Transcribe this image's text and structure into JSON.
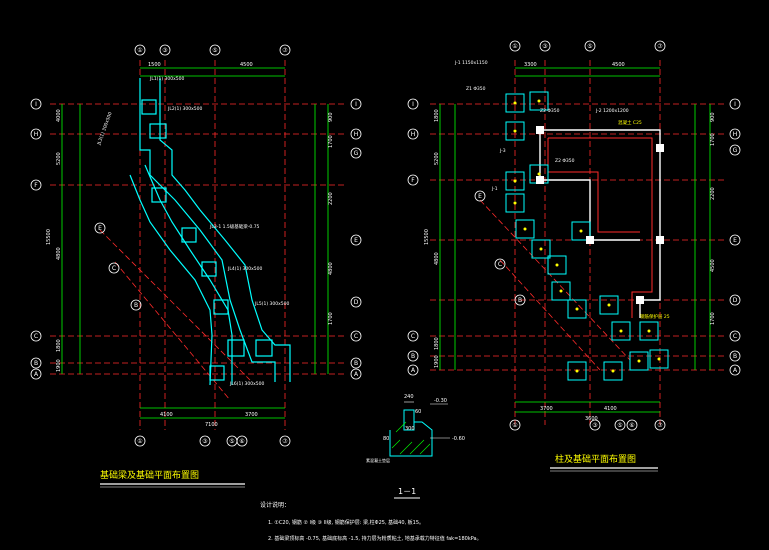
{
  "left_plan": {
    "title": "基础梁及基础平面布置图",
    "top_axes": [
      "①",
      "③",
      "⑤",
      "⑦"
    ],
    "bottom_axes": [
      "①",
      "③",
      "⑤",
      "⑥",
      "⑦"
    ],
    "left_axes": [
      "I",
      "H",
      "F",
      "C",
      "B",
      "A"
    ],
    "right_axes": [
      "I",
      "H",
      "G",
      "E",
      "D",
      "C",
      "B",
      "A"
    ],
    "diag_axes": [
      "E",
      "C",
      "B"
    ],
    "dims_top": [
      "1500",
      "4500"
    ],
    "dims_left": [
      "4000",
      "5200",
      "4800",
      "1800",
      "1900",
      "15500"
    ],
    "dims_right": [
      "900",
      "1700",
      "2200",
      "4800",
      "1700"
    ],
    "dims_bottom": [
      "4100",
      "3700",
      "7100"
    ],
    "beam_tags": [
      "JL1(1)  300x500",
      "JL2(1)  300x500",
      "JL3(1)  300x500",
      "JL4(1)  300x500",
      "JL5(1)  300x500",
      "JL6(1)  300x500"
    ],
    "note_center": "JL3-1  1.5级基础梁-0.75"
  },
  "right_plan": {
    "title": "柱及基础平面布置图",
    "top_axes": [
      "①",
      "③",
      "⑤",
      "⑦"
    ],
    "bottom_axes": [
      "①",
      "③",
      "⑤",
      "⑥",
      "⑦"
    ],
    "left_axes": [
      "I",
      "H",
      "F",
      "C",
      "B",
      "A"
    ],
    "right_axes": [
      "I",
      "H",
      "G",
      "E",
      "D",
      "C",
      "B",
      "A"
    ],
    "diag_axes": [
      "E",
      "C",
      "B"
    ],
    "dims_top": [
      "3300",
      "4500"
    ],
    "dims_left": [
      "1800",
      "5200",
      "4800",
      "1800",
      "1900",
      "15500"
    ],
    "dims_right": [
      "900",
      "1700",
      "2200",
      "4500",
      "1700"
    ],
    "dims_bottom": [
      "3700",
      "4100",
      "3600"
    ],
    "tags": {
      "z_top": "J-1  1150x1150",
      "z1": "Z1  Φ350",
      "z2": "Z2  Φ350",
      "j2": "J-2  1200x1200",
      "j3": "J-3",
      "j1": "J-1",
      "z2b": "Z2  Φ350",
      "note1": "混凝土  C25",
      "note2": "钢筋保护层  25"
    }
  },
  "section": {
    "label": "1－1",
    "dims": [
      "240",
      "60",
      "300",
      "80",
      "-0.30",
      "-0.60"
    ],
    "note": "素混凝土垫层"
  },
  "notes": {
    "heading": "设计说明：",
    "line1": "1.  ①C20,  钢筋    ② I级  ③ II级,  钢筋保护层: 梁,柱Φ25,  基础40,  板15。",
    "line2": "2.  基础梁顶标高 -0.75,  基础底标高 -1.5,  持力层为粉质粘土,  地基承载力特征值 fak=180kPa。"
  },
  "colors": {
    "background": "#000000",
    "axis": "#ffffff",
    "grid_red": "#ff2a2a",
    "beam_cyan": "#00ffff",
    "dim_green": "#00ff00",
    "column_white": "#ffffff",
    "text_yellow": "#ffff00",
    "text_white": "#ffffff"
  }
}
